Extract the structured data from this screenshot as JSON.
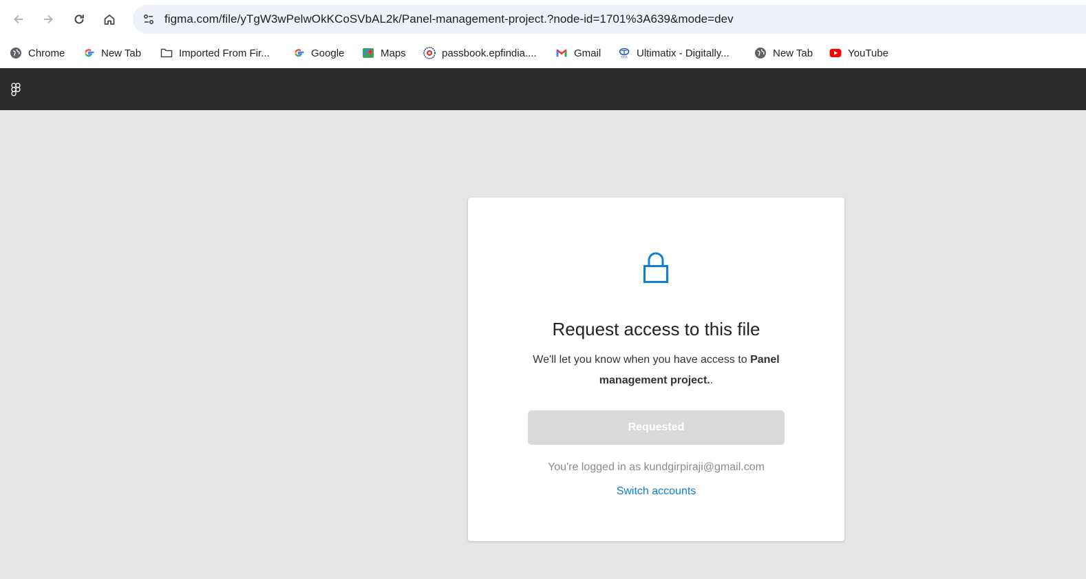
{
  "browser": {
    "url": "figma.com/file/yTgW3wPelwOkKCoSVbAL2k/Panel-management-project.?node-id=1701%3A639&mode=dev",
    "back_icon": "back-arrow-icon",
    "forward_icon": "forward-arrow-icon",
    "reload_icon": "reload-icon",
    "home_icon": "home-icon",
    "site_info_icon": "tune-icon"
  },
  "bookmarks": [
    {
      "label": "Chrome",
      "icon": "globe-icon"
    },
    {
      "label": "New Tab",
      "icon": "google-icon"
    },
    {
      "label": "Imported From Fir...",
      "icon": "folder-icon"
    },
    {
      "label": "Google",
      "icon": "google-icon"
    },
    {
      "label": "Maps",
      "icon": "maps-icon"
    },
    {
      "label": "passbook.epfindia....",
      "icon": "epfo-icon"
    },
    {
      "label": "Gmail",
      "icon": "gmail-icon"
    },
    {
      "label": "Ultimatix - Digitally...",
      "icon": "tata-icon"
    },
    {
      "label": "New Tab",
      "icon": "globe-icon"
    },
    {
      "label": "YouTube",
      "icon": "youtube-icon"
    }
  ],
  "figma": {
    "logo_icon": "figma-logo-icon"
  },
  "card": {
    "title": "Request access to this file",
    "desc_prefix": "We'll let you know when you have access to ",
    "desc_file": "Panel management project.",
    "desc_suffix": ".",
    "button_label": "Requested",
    "logged_in_text": "You're logged in as kundgirpiraji@gmail.com",
    "switch_label": "Switch accounts",
    "lock_icon": "lock-icon"
  },
  "colors": {
    "accent": "#0d7fd6",
    "header_bg": "#2c2c2c",
    "page_bg": "#e5e5e5",
    "disabled_button": "#d9d9d9"
  }
}
